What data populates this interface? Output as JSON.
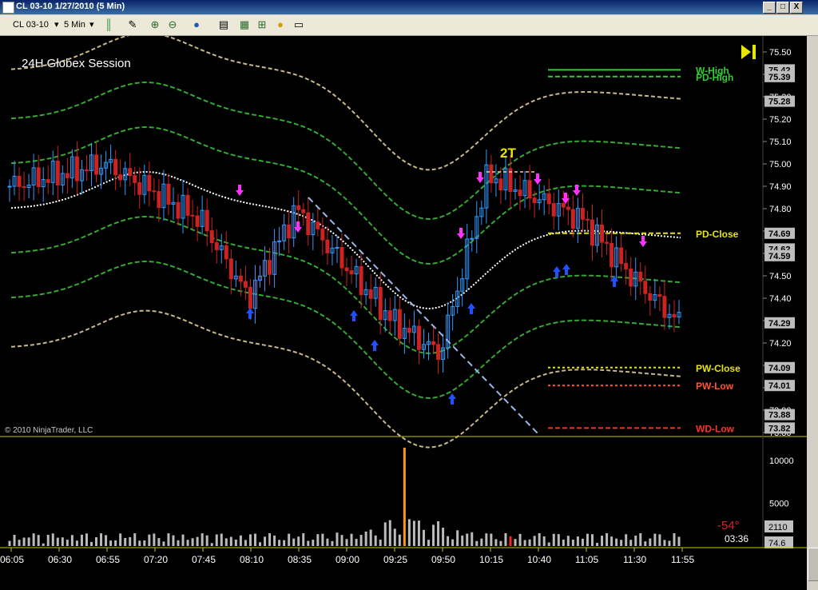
{
  "window": {
    "title": "CL 03-10  1/27/2010 (5 Min)",
    "controls": [
      "_",
      "□",
      "X"
    ]
  },
  "toolbar": {
    "instrument": "CL 03-10",
    "interval": "5 Min",
    "icons": [
      "bar-type-icon",
      "drawing-pen-icon",
      "zoom-in-icon",
      "zoom-out-icon",
      "globe-icon",
      "data-box-icon",
      "indicators-icon",
      "strategy-icon",
      "properties-icon"
    ]
  },
  "chart": {
    "session_label": "24H Globex Session",
    "copyright": "© 2010 NinjaTrader, LLC",
    "setup_label": "2T",
    "angle_readout": "-54°",
    "bar_timer": "03:36",
    "colors": {
      "background": "#000000",
      "up": "#3399ff",
      "down": "#cc2222",
      "separator": "#c8c800"
    },
    "price_axis": {
      "ticks": [
        "75.50",
        "75.40",
        "75.30",
        "75.20",
        "75.10",
        "75.00",
        "74.90",
        "74.80",
        "74.70",
        "74.60",
        "74.50",
        "74.40",
        "74.30",
        "74.20",
        "74.10",
        "74.00",
        "73.90",
        "73.80"
      ],
      "markers": [
        {
          "label": "75.42",
          "price": 75.42
        },
        {
          "label": "75.39",
          "price": 75.39
        },
        {
          "label": "75.28",
          "price": 75.28
        },
        {
          "label": "74.69",
          "price": 74.69
        },
        {
          "label": "74.62",
          "price": 74.62
        },
        {
          "label": "74.59",
          "price": 74.59
        },
        {
          "label": "74.29",
          "price": 74.29
        },
        {
          "label": "74.09",
          "price": 74.09
        },
        {
          "label": "74.01",
          "price": 74.01
        },
        {
          "label": "73.88",
          "price": 73.88
        },
        {
          "label": "73.82",
          "price": 73.82
        }
      ]
    },
    "levels": [
      {
        "label": "W-High",
        "price": 75.42,
        "color": "#33cc33",
        "style": "solid"
      },
      {
        "label": "PD-High",
        "price": 75.39,
        "color": "#33cc33",
        "style": "dash"
      },
      {
        "label": "PD-Close",
        "price": 74.69,
        "color": "#e6e600",
        "style": "dash"
      },
      {
        "label": "PW-Close",
        "price": 74.09,
        "color": "#e6e600",
        "style": "dot"
      },
      {
        "label": "PW-Low",
        "price": 74.01,
        "color": "#ff5533",
        "style": "dot"
      },
      {
        "label": "WD-Low",
        "price": 73.82,
        "color": "#ff3322",
        "style": "dash"
      }
    ],
    "time_axis": [
      "06:05",
      "06:30",
      "06:55",
      "07:20",
      "07:45",
      "08:10",
      "08:35",
      "09:00",
      "09:25",
      "09:50",
      "10:15",
      "10:40",
      "11:05",
      "11:30",
      "11:55"
    ],
    "volume_axis": {
      "ticks": [
        "10000",
        "5000"
      ],
      "readouts": [
        "2110",
        "74.6"
      ]
    }
  },
  "chart_data": {
    "type": "candlestick",
    "series_price_range": [
      73.8,
      75.5
    ],
    "approx_samples": [
      {
        "time": "06:05",
        "price": 74.9
      },
      {
        "time": "06:55",
        "price": 75.0
      },
      {
        "time": "07:45",
        "price": 74.75
      },
      {
        "time": "08:10",
        "price": 74.4
      },
      {
        "time": "08:35",
        "price": 74.8
      },
      {
        "time": "09:25",
        "price": 74.3
      },
      {
        "time": "09:50",
        "price": 74.15
      },
      {
        "time": "10:15",
        "price": 74.95
      },
      {
        "time": "10:40",
        "price": 74.85
      },
      {
        "time": "11:05",
        "price": 74.75
      },
      {
        "time": "11:30",
        "price": 74.5
      },
      {
        "time": "11:55",
        "price": 74.29
      }
    ],
    "volume_peak": 11500,
    "volume_ticks": [
      10000,
      5000
    ]
  }
}
